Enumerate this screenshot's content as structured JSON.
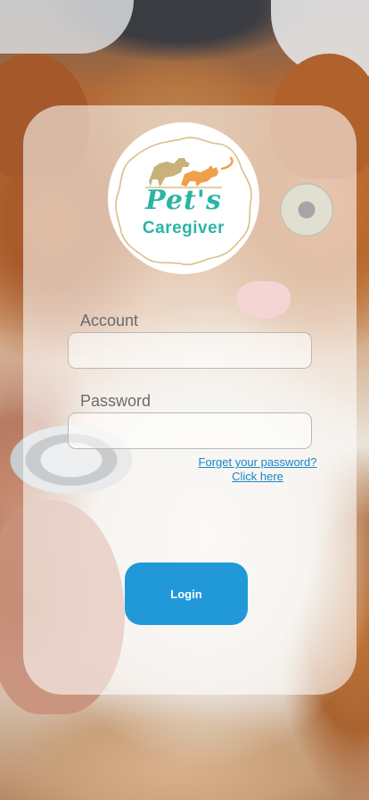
{
  "logo": {
    "line1": "Pet's",
    "line2": "Caregiver",
    "icon": "dog-and-cat-icon",
    "colors": {
      "text": "#2bb5a3",
      "dog": "#c8b27a",
      "cat": "#f0a04b",
      "ring": "#d8c08a"
    }
  },
  "form": {
    "account_label": "Account",
    "account_value": "",
    "password_label": "Password",
    "password_value": "",
    "forgot_line1": "Forget your password?",
    "forgot_line2": "Click here",
    "login_label": "Login"
  },
  "colors": {
    "accent": "#2199d9",
    "link": "#1a86c8"
  }
}
